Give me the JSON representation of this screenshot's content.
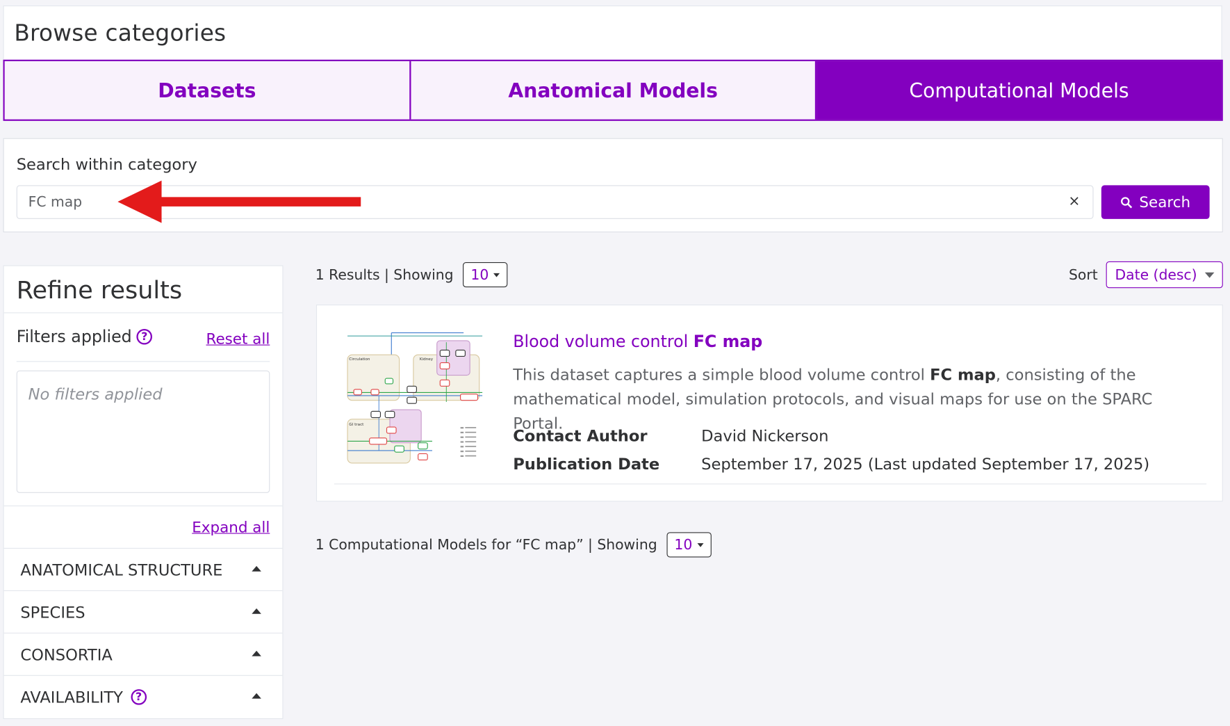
{
  "header": {
    "title": "Browse categories"
  },
  "tabs": [
    {
      "label": "Datasets",
      "active": false
    },
    {
      "label": "Anatomical Models",
      "active": false
    },
    {
      "label": "Computational Models",
      "active": true
    }
  ],
  "search": {
    "label": "Search within category",
    "value": "FC map",
    "placeholder": "",
    "clear_symbol": "×",
    "button_label": "Search"
  },
  "refine": {
    "title": "Refine results",
    "filters_applied_label": "Filters applied",
    "help_symbol": "?",
    "reset_all": "Reset all",
    "no_filters": "No filters applied",
    "expand_all": "Expand all",
    "facets": [
      "ANATOMICAL STRUCTURE",
      "SPECIES",
      "CONSORTIA",
      "AVAILABILITY"
    ]
  },
  "results_bar": {
    "count_text": "1 Results | Showing",
    "page_size": "10"
  },
  "sort": {
    "label": "Sort",
    "value": "Date (desc)"
  },
  "result": {
    "title_prefix": "Blood volume control ",
    "title_highlight": "FC map",
    "desc_1": "This dataset captures a simple blood volume control ",
    "desc_highlight": "FC map",
    "desc_2": ", consisting of the mathematical model, simulation protocols, and visual maps for use on the SPARC Portal.",
    "contact_label": "Contact Author",
    "contact_value": "David Nickerson",
    "pubdate_label": "Publication Date",
    "pubdate_value": "September 17, 2025 (Last updated September 17, 2025)",
    "thumb_labels": [
      "Circulation",
      "Kidney",
      "GI tract"
    ]
  },
  "bottom_bar": {
    "text": "1 Computational Models for “FC map” | Showing",
    "page_size": "10"
  },
  "colors": {
    "accent": "#8300bf",
    "arrow": "#e31b1b",
    "tab_bg": "#f9f2fc"
  }
}
